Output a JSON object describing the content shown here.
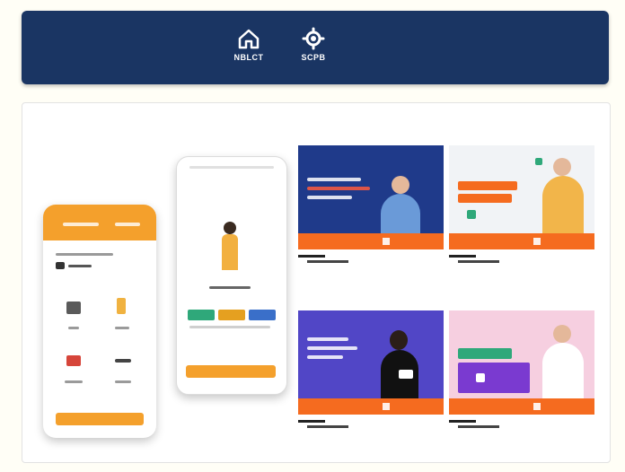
{
  "banner": {
    "items": [
      {
        "label": "NBLCT",
        "icon": "house-icon"
      },
      {
        "label": "SCPB",
        "icon": "gear-icon"
      }
    ]
  },
  "colors": {
    "banner": "#1a3563",
    "accent_orange": "#f4a02c",
    "card_orange": "#f56b1f"
  },
  "cards": [
    {
      "name": "video-card-1",
      "theme": "navy"
    },
    {
      "name": "video-card-2",
      "theme": "light"
    },
    {
      "name": "video-card-3",
      "theme": "purple"
    },
    {
      "name": "video-card-4",
      "theme": "pink"
    }
  ]
}
